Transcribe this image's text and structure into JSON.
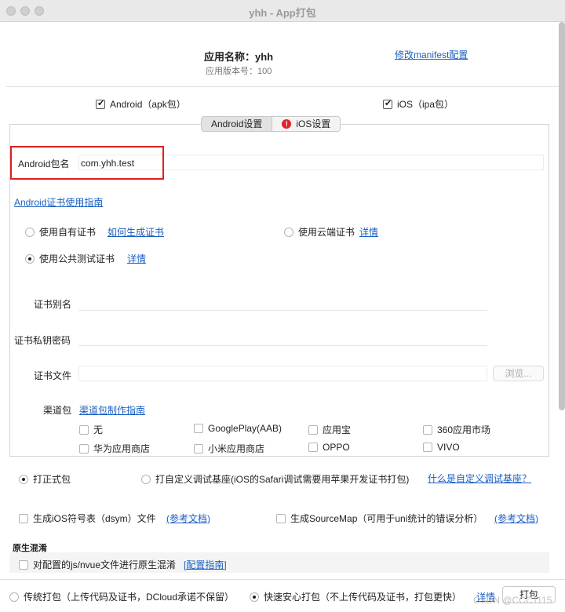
{
  "window": {
    "title": "yhh - App打包"
  },
  "header": {
    "app_name_label": "应用名称：yhh",
    "app_version_label": "应用版本号：100",
    "modify_manifest_link": "修改manifest配置"
  },
  "platforms": {
    "android": {
      "label": "Android（apk包）",
      "checked": true
    },
    "ios": {
      "label": "iOS（ipa包）",
      "checked": true
    }
  },
  "tabs": [
    {
      "label": "Android设置",
      "active": true
    },
    {
      "label": "iOS设置",
      "active": false,
      "error": true
    }
  ],
  "android": {
    "package_label": "Android包名",
    "package_value": "com.yhh.test",
    "cert_guide_link": "Android证书使用指南",
    "cert_options": {
      "own": {
        "label": "使用自有证书",
        "link": "如何生成证书",
        "checked": false
      },
      "cloud": {
        "label": "使用云端证书",
        "link": "详情",
        "checked": false
      },
      "public": {
        "label": "使用公共测试证书",
        "link": "详情",
        "checked": true
      }
    },
    "cert_alias_label": "证书别名",
    "cert_password_label": "证书私钥密码",
    "cert_file_label": "证书文件",
    "browse_button": "浏览...",
    "channel_label": "渠道包",
    "channel_guide_link": "渠道包制作指南",
    "channels": [
      {
        "label": "无",
        "checked": false
      },
      {
        "label": "GooglePlay(AAB)",
        "checked": false
      },
      {
        "label": "应用宝",
        "checked": false
      },
      {
        "label": "360应用市场",
        "checked": false
      },
      {
        "label": "华为应用商店",
        "checked": false
      },
      {
        "label": "小米应用商店",
        "checked": false
      },
      {
        "label": "OPPO",
        "checked": false
      },
      {
        "label": "VIVO",
        "checked": false
      }
    ]
  },
  "build_type": {
    "release": {
      "label": "打正式包",
      "checked": true
    },
    "custom_base": {
      "label": "打自定义调试基座(iOS的Safari调试需要用苹果开发证书打包)",
      "checked": false
    },
    "custom_base_link": "什么是自定义调试基座？"
  },
  "options": {
    "dsym": {
      "label": "生成iOS符号表（dsym）文件",
      "link": "(参考文档)",
      "checked": false
    },
    "sourcemap": {
      "label": "生成SourceMap（可用于uni统计的错误分析）",
      "link": "(参考文档)",
      "checked": false
    }
  },
  "obfuscation": {
    "section_label": "原生混淆",
    "option_label": "对配置的js/nvue文件进行原生混淆",
    "link": "[配置指南]",
    "checked": false
  },
  "footer": {
    "traditional": {
      "label": "传统打包（上传代码及证书，DCloud承诺不保留）",
      "checked": false
    },
    "secure": {
      "label": "快速安心打包（不上传代码及证书，打包更快）",
      "checked": true
    },
    "details_link": "详情",
    "pack_button": "打包"
  },
  "watermark": "CSDN @CCC1115",
  "colors": {
    "link": "#1a5fc1",
    "highlight_border": "#e02020",
    "error": "#e0242b"
  }
}
